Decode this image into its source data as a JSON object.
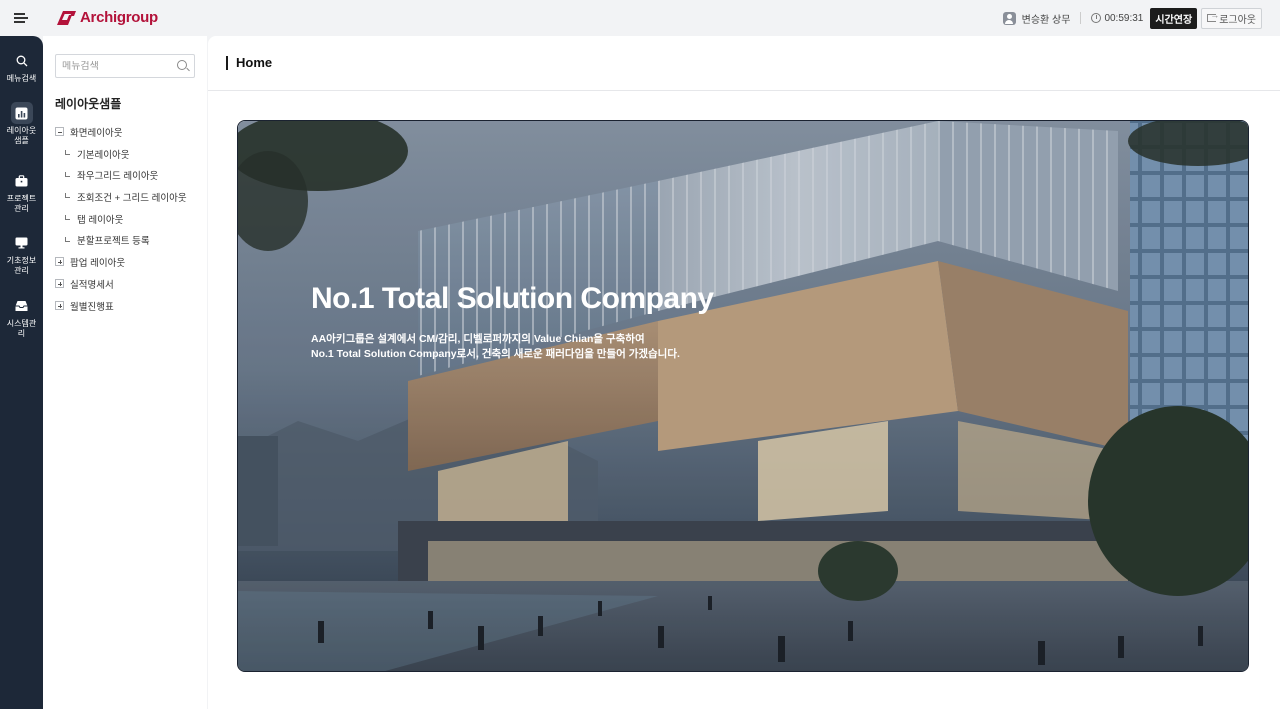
{
  "topbar": {
    "logo_text": "Archigroup",
    "brand_color": "#b3123a",
    "user_name": "변승환 상무",
    "timer": "00:59:31",
    "extend_label": "시간연장",
    "logout_label": "로그아웃"
  },
  "rail": {
    "items": [
      {
        "label": "메뉴검색",
        "icon": "search-icon"
      },
      {
        "label": "레이아웃\n샘플",
        "icon": "chart-icon",
        "active": true
      },
      {
        "label": "프로젝트\n관리",
        "icon": "briefcase-icon"
      },
      {
        "label": "기초정보\n관리",
        "icon": "monitor-icon"
      },
      {
        "label": "시스템관\n리",
        "icon": "inbox-icon"
      }
    ]
  },
  "sidebar": {
    "search_placeholder": "메뉴검색",
    "title": "레이아웃샘플",
    "tree": {
      "group1": "화면레이아웃",
      "children": [
        "기본레이아웃",
        "좌우그리드 레이아웃",
        "조회조건 + 그리드 레이아웃",
        "탭 레이아웃",
        "분할프로젝트 등록"
      ],
      "group2": "팝업 레이아웃",
      "group3": "실적명세서",
      "group4": "월별진행표"
    }
  },
  "main": {
    "title": "Home",
    "hero_headline": "No.1 Total Solution Company",
    "hero_line1": "AA아키그룹은 설계에서 CM/감리, 디벨로퍼까지의 Value Chian을 구축하여",
    "hero_line2": "No.1 Total Solution Company로서, 건축의 새로운 패러다임을 만들어 가겠습니다."
  }
}
